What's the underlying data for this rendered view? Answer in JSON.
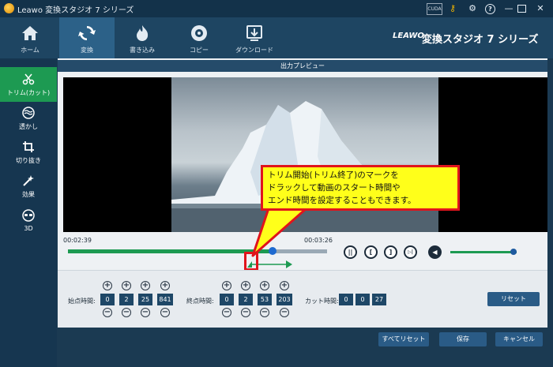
{
  "window": {
    "title": "Leawo 変換スタジオ 7 シリーズ",
    "gpu_label": "CUDA"
  },
  "nav": {
    "items": [
      {
        "label": "ホーム",
        "icon": "home-icon"
      },
      {
        "label": "変換",
        "icon": "convert-icon"
      },
      {
        "label": "書き込み",
        "icon": "burn-icon"
      },
      {
        "label": "コピー",
        "icon": "copy-icon"
      },
      {
        "label": "ダウンロード",
        "icon": "download-icon"
      }
    ],
    "active": "変換",
    "brand_logo": "LEAWO",
    "brand_title": "変換スタジオ 7 シリーズ"
  },
  "sidebar": {
    "items": [
      {
        "label": "トリム(カット)",
        "icon": "scissors-icon"
      },
      {
        "label": "透かし",
        "icon": "watermark-icon"
      },
      {
        "label": "切り抜き",
        "icon": "crop-icon"
      },
      {
        "label": "効果",
        "icon": "effect-icon"
      },
      {
        "label": "3D",
        "icon": "3d-glasses-icon"
      }
    ],
    "active": "トリム(カット)"
  },
  "preview": {
    "header": "出力プレビュー",
    "current_time": "00:02:39",
    "end_time": "00:03:26",
    "progress": 0.79
  },
  "playback": {
    "pause": "||",
    "mark_start": "[",
    "mark_end": "]",
    "next": "▷|",
    "volume_icon": "speaker-icon",
    "volume_level": 0.95
  },
  "callout": {
    "lines": [
      "トリム開始(トリム終了)のマークを",
      "ドラックして動画のスタート時間や",
      "エンド時間を設定することもできます。"
    ]
  },
  "trim": {
    "start_label": "始点時間:",
    "start_values": [
      "0",
      "2",
      "25",
      "841"
    ],
    "end_label": "終点時間:",
    "end_values": [
      "0",
      "2",
      "53",
      "203"
    ],
    "cut_label": "カット時間:",
    "cut_values": [
      "0",
      "0",
      "27"
    ],
    "plus": "+",
    "minus": "−",
    "reset_label": "リセット"
  },
  "footer": {
    "reset_all_label": "すべてリセット",
    "save_label": "保存",
    "cancel_label": "キャンセル"
  },
  "colors": {
    "accent_green": "#1d9a52",
    "callout_yellow": "#ffff1a",
    "callout_border": "#e0141c"
  }
}
